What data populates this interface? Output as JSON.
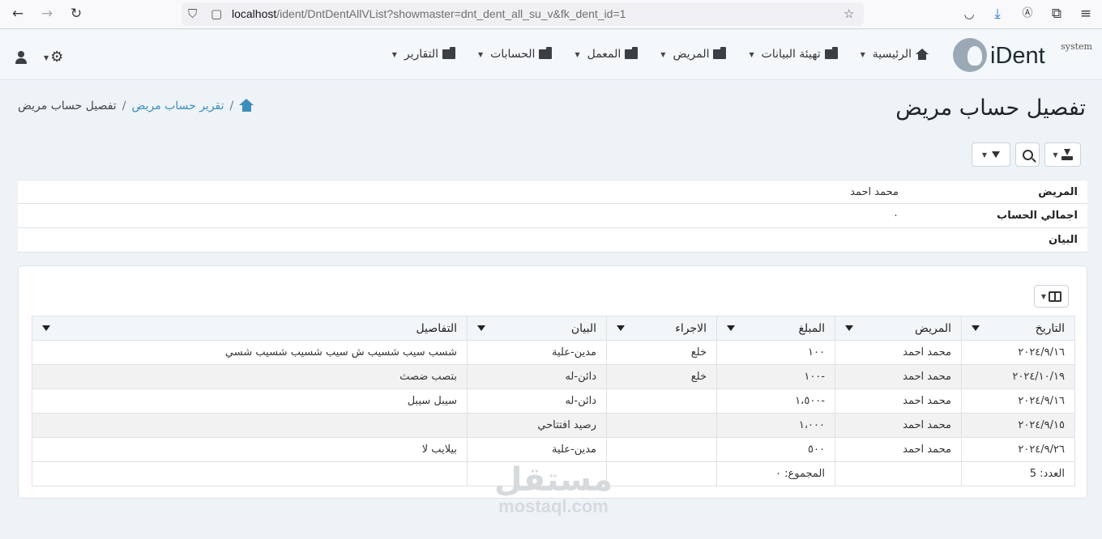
{
  "browser": {
    "url_host": "localhost",
    "url_path": "/ident/DntDentAllVList?showmaster=dnt_dent_all_su_v&fk_dent_id=1"
  },
  "app": {
    "logo_text": "iDent",
    "logo_sub": "system",
    "nav": [
      {
        "label": "الرئيسية",
        "icon": "home-icon"
      },
      {
        "label": "تهيئة البيانات",
        "icon": "folder-icon"
      },
      {
        "label": "المريض",
        "icon": "folder-icon"
      },
      {
        "label": "المعمل",
        "icon": "folder-icon"
      },
      {
        "label": "الحسابات",
        "icon": "folder-icon"
      },
      {
        "label": "التقارير",
        "icon": "folder-icon"
      }
    ]
  },
  "page": {
    "title": "تفصيل حساب مريض",
    "breadcrumb": {
      "parent": "تقرير حساب مريض",
      "current": "تفصيل حساب مريض"
    }
  },
  "master": [
    {
      "label": "المريض",
      "value": "محمد احمد"
    },
    {
      "label": "اجمالي الحساب",
      "value": "٠"
    },
    {
      "label": "البيان",
      "value": ""
    }
  ],
  "grid": {
    "columns": [
      "التاريخ",
      "المريض",
      "المبلغ",
      "الاجراء",
      "البيان",
      "التفاصيل"
    ],
    "rows": [
      [
        "٢٠٢٤/٩/١٦",
        "محمد احمد",
        "١٠٠",
        "خلع",
        "مدين-علية",
        "شسب سيب شسيب ش سيب شسيب شسيب شسي"
      ],
      [
        "٢٠٢٤/١٠/١٩",
        "محمد احمد",
        "-١٠٠",
        "خلع",
        "دائن-له",
        "بتصب ضصث"
      ],
      [
        "٢٠٢٤/٩/١٦",
        "محمد احمد",
        "-١،٥٠٠",
        "",
        "دائن-له",
        "سيبل سيبل"
      ],
      [
        "٢٠٢٤/٩/١٥",
        "محمد احمد",
        "١،٠٠٠",
        "",
        "رصيد افتتاحي",
        ""
      ],
      [
        "٢٠٢٤/٩/٢٦",
        "محمد احمد",
        "٥٠٠",
        "",
        "مدين-علية",
        "بيلايب لا"
      ]
    ],
    "footer": {
      "count": "العدد: 5",
      "sum": "المجموع: ٠"
    }
  },
  "watermark": {
    "arabic": "مستقل",
    "latin": "mostaql.com"
  }
}
